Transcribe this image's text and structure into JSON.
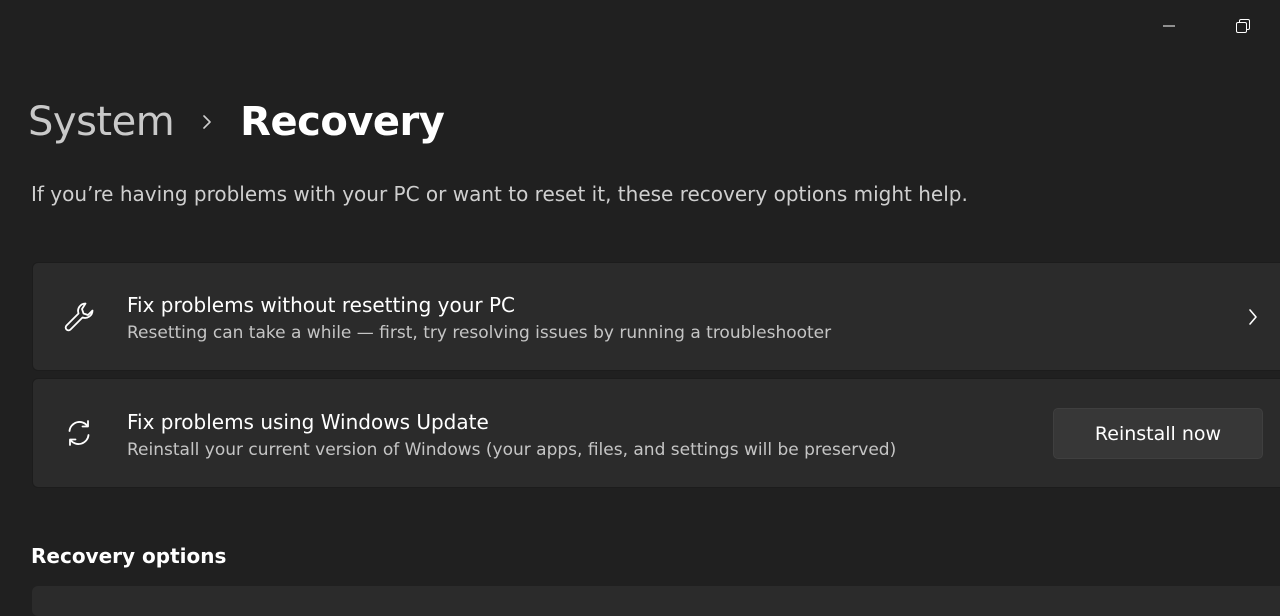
{
  "window": {
    "controls": [
      "minimize-icon",
      "restore-icon"
    ]
  },
  "breadcrumb": {
    "parent": "System",
    "current": "Recovery"
  },
  "description": "If you’re having problems with your PC or want to reset it, these recovery options might help.",
  "cards": [
    {
      "icon": "wrench-icon",
      "title": "Fix problems without resetting your PC",
      "subtitle": "Resetting can take a while — first, try resolving issues by running a troubleshooter"
    },
    {
      "icon": "sync-icon",
      "title": "Fix problems using Windows Update",
      "subtitle": "Reinstall your current version of Windows (your apps, files, and settings will be preserved)",
      "button_label": "Reinstall now"
    }
  ],
  "sections": {
    "recovery_options": "Recovery options"
  },
  "colors": {
    "background": "#202020",
    "card": "#2b2b2b",
    "button": "#373737"
  }
}
